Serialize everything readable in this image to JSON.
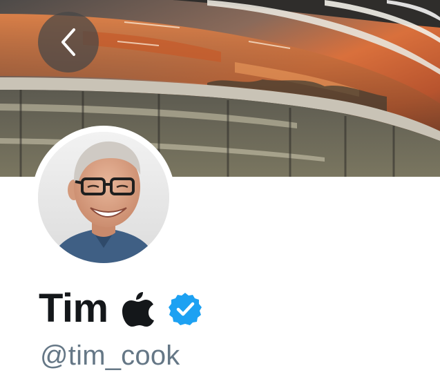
{
  "header": {
    "banner_image": "apple-park-ring-building-at-sunset",
    "back_icon": "chevron-left-icon"
  },
  "profile": {
    "avatar": "profile-photo-smiling-man-with-glasses",
    "display_name": "Tim",
    "name_emoji_icon": "apple-logo-icon",
    "verified_icon": "verified-badge-icon",
    "handle": "@tim_cook"
  },
  "colors": {
    "name_text": "#14171a",
    "handle_text": "#657786",
    "verified_blue": "#1da1f2",
    "background": "#ffffff"
  }
}
